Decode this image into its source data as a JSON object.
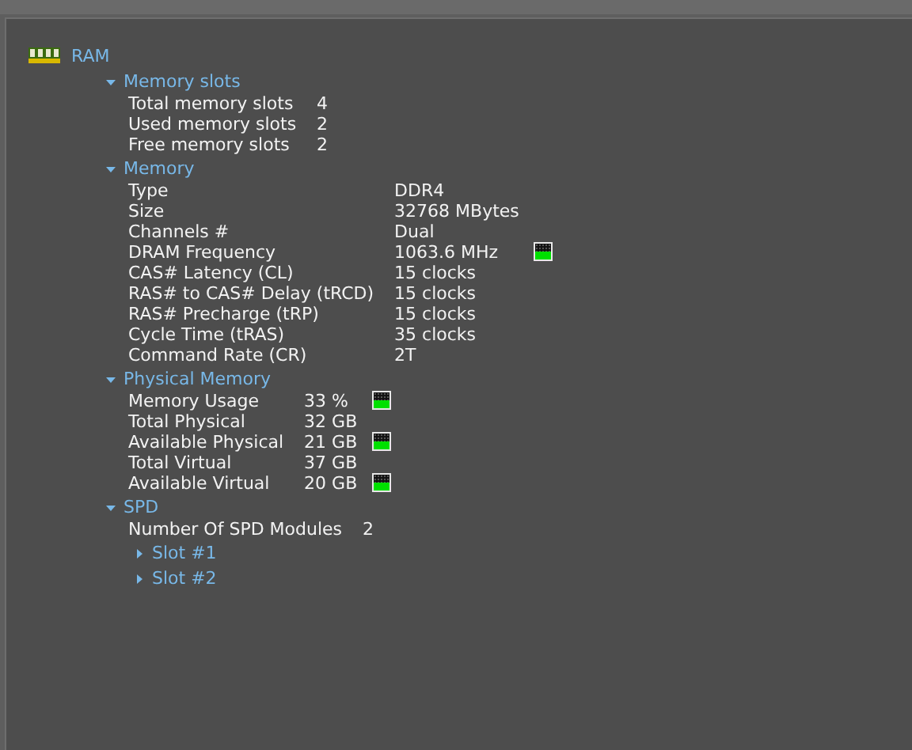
{
  "root": {
    "label": "RAM"
  },
  "sections": [
    {
      "title": "Memory slots",
      "expanded": true,
      "rows": [
        {
          "label": "Total memory slots",
          "value": "4"
        },
        {
          "label": "Used memory slots",
          "value": "2"
        },
        {
          "label": "Free memory slots",
          "value": "2"
        }
      ]
    },
    {
      "title": "Memory",
      "expanded": true,
      "rows": [
        {
          "label": "Type",
          "value": "DDR4"
        },
        {
          "label": "Size",
          "value": "32768 MBytes"
        },
        {
          "label": "Channels #",
          "value": "Dual"
        },
        {
          "label": "DRAM Frequency",
          "value": "1063.6 MHz",
          "meter": true
        },
        {
          "label": "CAS# Latency (CL)",
          "value": "15 clocks"
        },
        {
          "label": "RAS# to CAS# Delay (tRCD)",
          "value": "15 clocks"
        },
        {
          "label": "RAS# Precharge (tRP)",
          "value": "15 clocks"
        },
        {
          "label": "Cycle Time (tRAS)",
          "value": "35 clocks"
        },
        {
          "label": "Command Rate (CR)",
          "value": "2T"
        }
      ]
    },
    {
      "title": "Physical Memory",
      "expanded": true,
      "rows": [
        {
          "label": "Memory Usage",
          "value": "33 %",
          "meter": true
        },
        {
          "label": "Total Physical",
          "value": "32 GB"
        },
        {
          "label": "Available Physical",
          "value": "21 GB",
          "meter": true
        },
        {
          "label": "Total Virtual",
          "value": "37 GB"
        },
        {
          "label": "Available Virtual",
          "value": "20 GB",
          "meter": true
        }
      ]
    },
    {
      "title": "SPD",
      "expanded": true,
      "rows": [
        {
          "label": "Number Of SPD Modules",
          "value": "2"
        }
      ],
      "children": [
        {
          "title": "Slot #1",
          "expanded": false
        },
        {
          "title": "Slot #2",
          "expanded": false
        }
      ]
    }
  ]
}
